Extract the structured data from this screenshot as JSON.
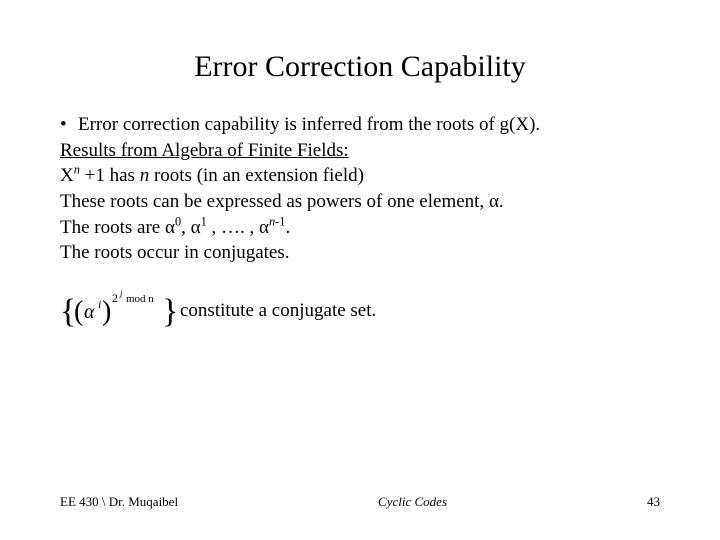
{
  "title": "Error Correction Capability",
  "bullet": "Error correction capability is inferred from the roots of g(X).",
  "line_results": "Results from Algebra of Finite Fields:",
  "line_xn_pre": "X",
  "line_xn_sup": "n",
  "line_xn_post": " +1 has ",
  "line_xn_ital": "n",
  "line_xn_tail": " roots (in an extension field)",
  "line_powers_pre": "These roots can be expressed as powers of one element, ",
  "alpha": "α",
  "period": ".",
  "line_roots_pre": "The roots are ",
  "sup0": "0",
  "comma_sp": ", ",
  "sup1": "1",
  "dots": " , …. , ",
  "sup_nm1_n": "n",
  "sup_nm1_tail": "-1",
  "line_conj": "The roots occur in conjugates.",
  "eq_text": " constitute a conjugate set.",
  "footer_left": "EE 430 \\ Dr. Muqaibel",
  "footer_center": "Cyclic Codes",
  "footer_right": "43"
}
